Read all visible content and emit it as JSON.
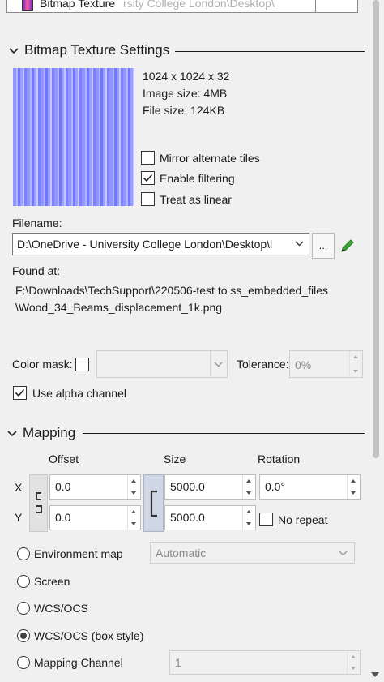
{
  "texture_selector": {
    "label": "Bitmap Texture",
    "faded_path": "rsity College London\\Desktop\\"
  },
  "bitmap_section": {
    "title": "Bitmap Texture Settings",
    "dimensions": "1024 x 1024 x 32",
    "image_size": "Image size: 4MB",
    "file_size": "File size: 124KB",
    "mirror_label": "Mirror alternate tiles",
    "mirror_checked": false,
    "filtering_label": "Enable filtering",
    "filtering_checked": true,
    "linear_label": "Treat as linear",
    "linear_checked": false,
    "filename_label": "Filename:",
    "filename_value": "D:\\OneDrive - University College London\\Desktop\\l",
    "browse_label": "...",
    "found_label": "Found at:",
    "found_line1": "F:\\Downloads\\TechSupport\\220506-test to ss_embedded_files",
    "found_line2": "\\Wood_34_Beams_displacement_1k.png",
    "color_mask_label": "Color mask:",
    "tolerance_label": "Tolerance:",
    "tolerance_value": "0%",
    "alpha_label": "Use alpha channel",
    "alpha_checked": true
  },
  "mapping_section": {
    "title": "Mapping",
    "col_offset": "Offset",
    "col_size": "Size",
    "col_rotation": "Rotation",
    "row_x": "X",
    "row_y": "Y",
    "offset_x": "0.0",
    "offset_y": "0.0",
    "size_x": "5000.0",
    "size_y": "5000.0",
    "rotation": "0.0°",
    "no_repeat_label": "No repeat",
    "env_map_label": "Environment map",
    "env_map_option": "Automatic",
    "screen_label": "Screen",
    "wcs_label": "WCS/OCS",
    "wcs_box_label": "WCS/OCS (box style)",
    "channel_label": "Mapping Channel",
    "channel_value": "1",
    "selected_mode": "WCS/OCS (box style)"
  },
  "colors": {
    "texture_blue": "#8f96ff",
    "accent_green": "#3aa635",
    "text": "#1a1a1a"
  }
}
